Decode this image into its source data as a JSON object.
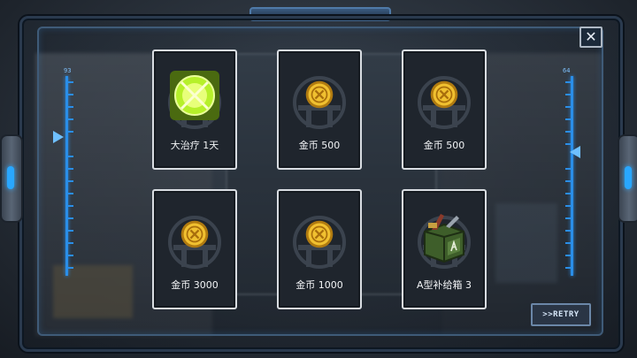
{
  "gauges": {
    "left_value": "93",
    "right_value": "64"
  },
  "buttons": {
    "close_glyph": "✕",
    "retry_label": ">>RETRY"
  },
  "rewards": [
    {
      "label": "大治疗 1天",
      "icon": "heal-orb-icon"
    },
    {
      "label": "金币 500",
      "icon": "gold-coin-icon"
    },
    {
      "label": "金币 500",
      "icon": "gold-coin-icon"
    },
    {
      "label": "金币 3000",
      "icon": "gold-coin-icon"
    },
    {
      "label": "金币 1000",
      "icon": "gold-coin-icon"
    },
    {
      "label": "A型补给箱 3",
      "icon": "supply-crate-icon"
    }
  ],
  "colors": {
    "accent": "#2a8ee8",
    "card_border": "#d9dde2",
    "coin": "#e8b420",
    "heal": "#c8ff3a"
  }
}
